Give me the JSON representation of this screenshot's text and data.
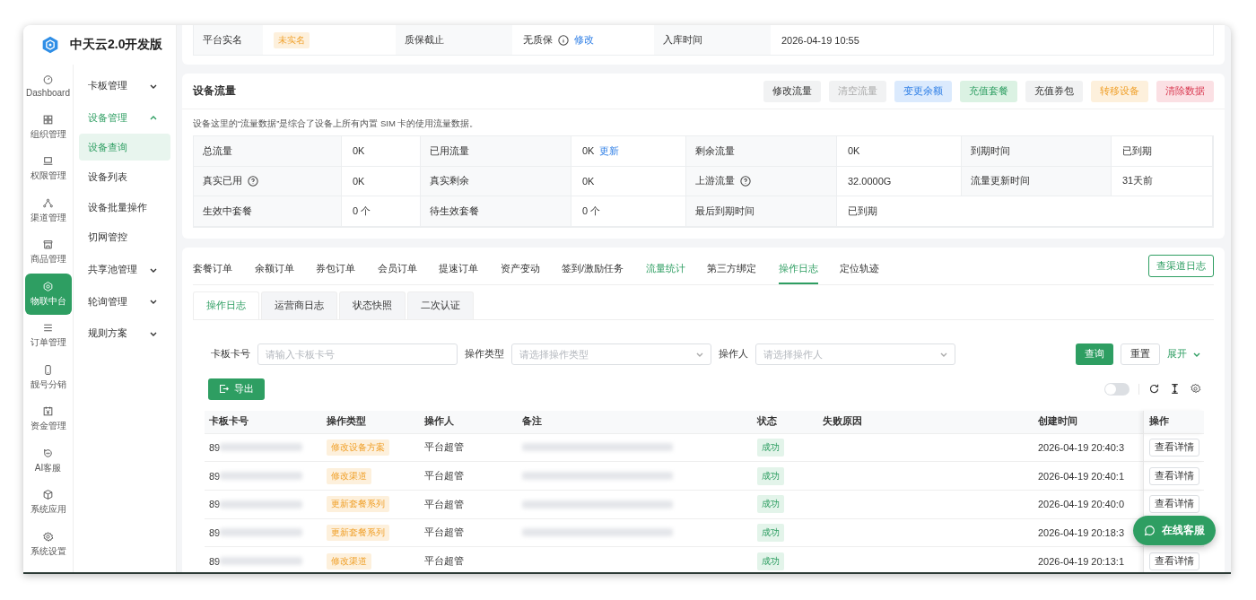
{
  "app": {
    "title": "中天云2.0开发版"
  },
  "rail": [
    {
      "label": "Dashboard",
      "selected": false
    },
    {
      "label": "组织管理",
      "selected": false
    },
    {
      "label": "权限管理",
      "selected": false
    },
    {
      "label": "渠道管理",
      "selected": false
    },
    {
      "label": "商品管理",
      "selected": false
    },
    {
      "label": "物联中台",
      "selected": true
    },
    {
      "label": "订单管理",
      "selected": false
    },
    {
      "label": "靓号分销",
      "selected": false
    },
    {
      "label": "资金管理",
      "selected": false
    },
    {
      "label": "AI客服",
      "selected": false
    },
    {
      "label": "系统应用",
      "selected": false
    },
    {
      "label": "系统设置",
      "selected": false
    }
  ],
  "submenu": [
    {
      "label": "卡板管理",
      "expanded": false
    },
    {
      "label": "设备管理",
      "expanded": true,
      "children": [
        {
          "label": "设备查询",
          "selected": true
        },
        {
          "label": "设备列表",
          "selected": false
        },
        {
          "label": "设备批量操作",
          "selected": false
        },
        {
          "label": "切网管控",
          "selected": false
        }
      ]
    },
    {
      "label": "共享池管理",
      "expanded": false
    },
    {
      "label": "轮询管理",
      "expanded": false
    },
    {
      "label": "规则方案",
      "expanded": false
    }
  ],
  "info": {
    "realname_label": "平台实名",
    "realname_tag": "未实名",
    "warranty_label": "质保截止",
    "warranty_value": "无质保",
    "warranty_link": "修改",
    "stock_label": "入库时间",
    "stock_value": "2026-04-19 10:55"
  },
  "flow": {
    "title": "设备流量",
    "buttons": [
      {
        "label": "修改流量",
        "kind": "default"
      },
      {
        "label": "清空流量",
        "kind": "muted"
      },
      {
        "label": "变更余额",
        "kind": "blue"
      },
      {
        "label": "充值套餐",
        "kind": "green"
      },
      {
        "label": "充值券包",
        "kind": "default"
      },
      {
        "label": "转移设备",
        "kind": "orange"
      },
      {
        "label": "清除数据",
        "kind": "red"
      }
    ],
    "note": "设备这里的“流量数据”是综合了设备上所有内置 SIM 卡的使用流量数据。",
    "rows": [
      [
        {
          "label": "总流量",
          "value": "0K"
        },
        {
          "label": "已用流量",
          "value": "0K",
          "link": "更新"
        },
        {
          "label": "剩余流量",
          "value": "0K"
        },
        {
          "label": "到期时间",
          "value": "已到期"
        }
      ],
      [
        {
          "label": "真实已用",
          "value": "0K",
          "help": true
        },
        {
          "label": "真实剩余",
          "value": "0K"
        },
        {
          "label": "上游流量",
          "value": "32.0000G",
          "help": true
        },
        {
          "label": "流量更新时间",
          "value": "31天前"
        }
      ],
      [
        {
          "label": "生效中套餐",
          "value": "0 个"
        },
        {
          "label": "待生效套餐",
          "value": "0 个"
        },
        {
          "label": "最后到期时间",
          "value": "已到期"
        }
      ]
    ]
  },
  "tabs": [
    {
      "label": "套餐订单",
      "selected": false,
      "highlighted": false
    },
    {
      "label": "余额订单",
      "selected": false,
      "highlighted": false
    },
    {
      "label": "券包订单",
      "selected": false,
      "highlighted": false
    },
    {
      "label": "会员订单",
      "selected": false,
      "highlighted": false
    },
    {
      "label": "提速订单",
      "selected": false,
      "highlighted": false
    },
    {
      "label": "资产变动",
      "selected": false,
      "highlighted": false
    },
    {
      "label": "签到/激励任务",
      "selected": false,
      "highlighted": false
    },
    {
      "label": "流量统计",
      "selected": false,
      "highlighted": true
    },
    {
      "label": "第三方绑定",
      "selected": false,
      "highlighted": false
    },
    {
      "label": "操作日志",
      "selected": true,
      "highlighted": false
    },
    {
      "label": "定位轨迹",
      "selected": false,
      "highlighted": false
    }
  ],
  "channel_log_button": "查渠道日志",
  "subtabs": [
    {
      "label": "操作日志",
      "selected": true
    },
    {
      "label": "运营商日志",
      "selected": false
    },
    {
      "label": "状态快照",
      "selected": false
    },
    {
      "label": "二次认证",
      "selected": false
    }
  ],
  "filters": [
    {
      "label": "卡板卡号",
      "placeholder": "请输入卡板卡号",
      "kind": "input"
    },
    {
      "label": "操作类型",
      "placeholder": "请选择操作类型",
      "kind": "select"
    },
    {
      "label": "操作人",
      "placeholder": "请选择操作人",
      "kind": "select"
    }
  ],
  "query_button": "查询",
  "reset_button": "重置",
  "expand_link": "展开",
  "export_button": "导出",
  "toolbar": {
    "switch_on": false
  },
  "table": {
    "columns": [
      "卡板卡号",
      "操作类型",
      "操作人",
      "备注",
      "状态",
      "失败原因",
      "创建时间",
      "操作"
    ],
    "rows": [
      {
        "card": "89",
        "type": "修改设备方案",
        "operator": "平台超管",
        "remark_blurred": true,
        "status": "成功",
        "created": "2026-04-19 20:40:3",
        "action": "查看详情"
      },
      {
        "card": "89",
        "type": "修改渠道",
        "operator": "平台超管",
        "remark_blurred": true,
        "status": "成功",
        "created": "2026-04-19 20:40:1",
        "action": "查看详情"
      },
      {
        "card": "89",
        "type": "更新套餐系列",
        "operator": "平台超管",
        "remark_blurred": true,
        "status": "成功",
        "created": "2026-04-19 20:40:0",
        "action": "查看详情"
      },
      {
        "card": "89",
        "type": "更新套餐系列",
        "operator": "平台超管",
        "remark_blurred": true,
        "status": "成功",
        "created": "2026-04-19 20:18:3"
      },
      {
        "card": "89",
        "type": "修改渠道",
        "operator": "平台超管",
        "remark_blurred": false,
        "status": "成功",
        "created": "2026-04-19 20:13:1",
        "action": "查看详情"
      }
    ]
  },
  "chat_button": "在线客服"
}
